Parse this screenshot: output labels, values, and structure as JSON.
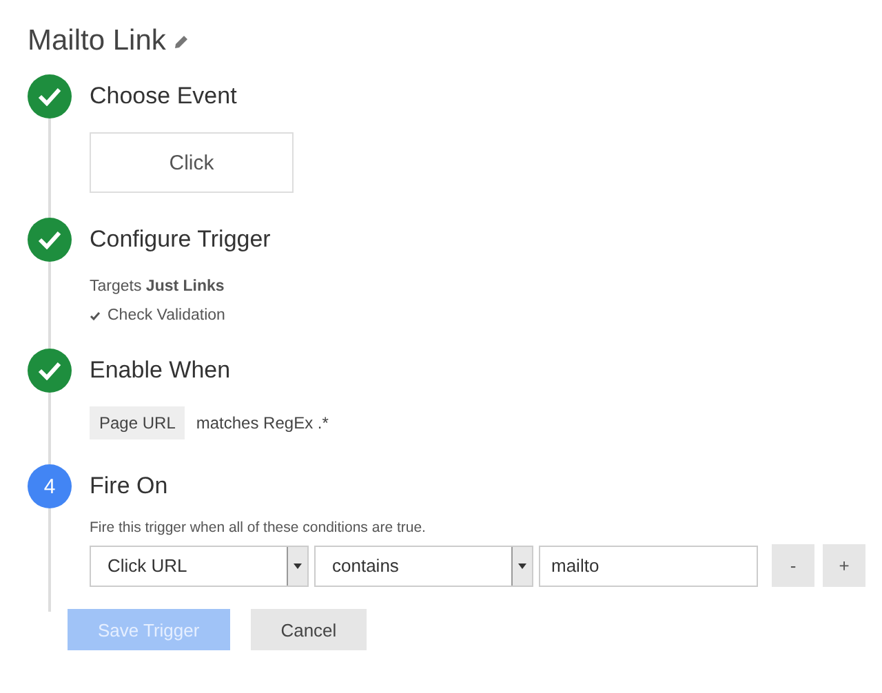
{
  "title": "Mailto Link",
  "steps": [
    {
      "completed": true,
      "title": "Choose Event",
      "body": {
        "kind": "event",
        "label": "Click"
      }
    },
    {
      "completed": true,
      "title": "Configure Trigger",
      "body": {
        "kind": "summary",
        "targets": "Targets **Just Links**",
        "check": "Check Validation"
      }
    },
    {
      "completed": true,
      "title": "Enable When",
      "body": {
        "kind": "filter",
        "variable": "Page URL",
        "condition": "matches RegEx .*"
      }
    },
    {
      "completed": false,
      "number": "4",
      "title": "Fire On",
      "body": {
        "kind": "conditions",
        "intro": "Fire this trigger when all of these conditions are true.",
        "variable": "Click URL",
        "operator": "contains",
        "value": "mailto",
        "remove": "-",
        "add": "+"
      }
    }
  ],
  "buttons": [
    {
      "kind": "primary",
      "label": "Save Trigger",
      "disabled": true
    },
    {
      "kind": "secondary",
      "label": "Cancel",
      "disabled": false
    }
  ]
}
